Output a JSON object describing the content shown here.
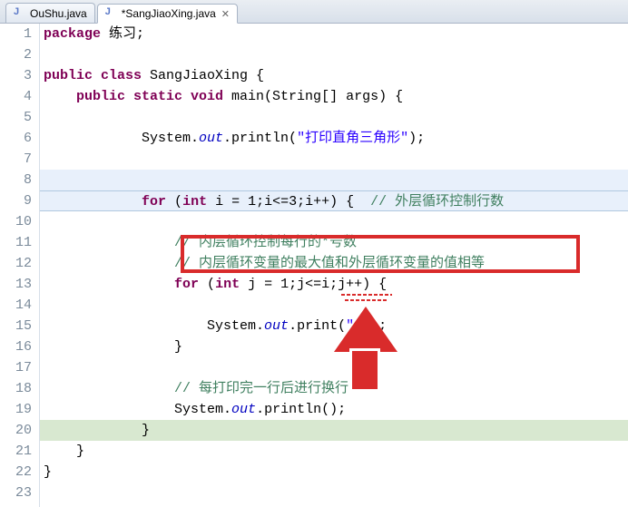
{
  "tabs": [
    {
      "label": "OuShu.java",
      "active": false
    },
    {
      "label": "*SangJiaoXing.java",
      "active": true
    }
  ],
  "lines": {
    "1": {
      "text": "package 练习;",
      "parts": [
        [
          "kw",
          "package "
        ],
        [
          "",
          "练习;"
        ]
      ]
    },
    "2": {
      "text": ""
    },
    "3": {
      "parts": [
        [
          "kw",
          "public class "
        ],
        [
          "",
          "SangJiaoXing {"
        ]
      ]
    },
    "4": {
      "parts": [
        [
          "",
          "    "
        ],
        [
          "kw",
          "public static void "
        ],
        [
          "",
          "main(String[] args) {"
        ]
      ]
    },
    "5": {
      "text": ""
    },
    "6": {
      "parts": [
        [
          "",
          "            System."
        ],
        [
          "it",
          "out"
        ],
        [
          "",
          ".println("
        ],
        [
          "str",
          "\"打印直角三角形\""
        ],
        [
          "",
          ");"
        ]
      ]
    },
    "7": {
      "text": ""
    },
    "8": {
      "text": ""
    },
    "9": {
      "parts": [
        [
          "",
          "            "
        ],
        [
          "kw",
          "for "
        ],
        [
          "",
          "("
        ],
        [
          "kw",
          "int "
        ],
        [
          "",
          "i = 1;i<=3;i++) {  "
        ],
        [
          "cmt",
          "// 外层循环控制行数"
        ]
      ]
    },
    "10": {
      "text": ""
    },
    "11": {
      "parts": [
        [
          "",
          "                "
        ],
        [
          "cmt",
          "// 内层循环控制每行的*号数"
        ]
      ]
    },
    "12": {
      "parts": [
        [
          "",
          "                "
        ],
        [
          "cmt",
          "// 内层循环变量的最大值和外层循环变量的值相等"
        ]
      ]
    },
    "13": {
      "parts": [
        [
          "",
          "                "
        ],
        [
          "kw",
          "for "
        ],
        [
          "",
          "("
        ],
        [
          "kw",
          "int "
        ],
        [
          "",
          "j = 1;j<=i;j++) {"
        ]
      ]
    },
    "14": {
      "text": ""
    },
    "15": {
      "parts": [
        [
          "",
          "                    System."
        ],
        [
          "it",
          "out"
        ],
        [
          "",
          ".print("
        ],
        [
          "str",
          "\"*\""
        ],
        [
          "",
          ");"
        ]
      ]
    },
    "16": {
      "text": "                }"
    },
    "17": {
      "text": ""
    },
    "18": {
      "parts": [
        [
          "",
          "                "
        ],
        [
          "cmt",
          "// 每打印完一行后进行换行"
        ]
      ]
    },
    "19": {
      "parts": [
        [
          "",
          "                System."
        ],
        [
          "it",
          "out"
        ],
        [
          "",
          ".println();"
        ]
      ]
    },
    "20": {
      "text": "            }"
    },
    "21": {
      "text": "    }"
    },
    "22": {
      "text": "}"
    },
    "23": {
      "text": ""
    }
  },
  "line_count": 23
}
